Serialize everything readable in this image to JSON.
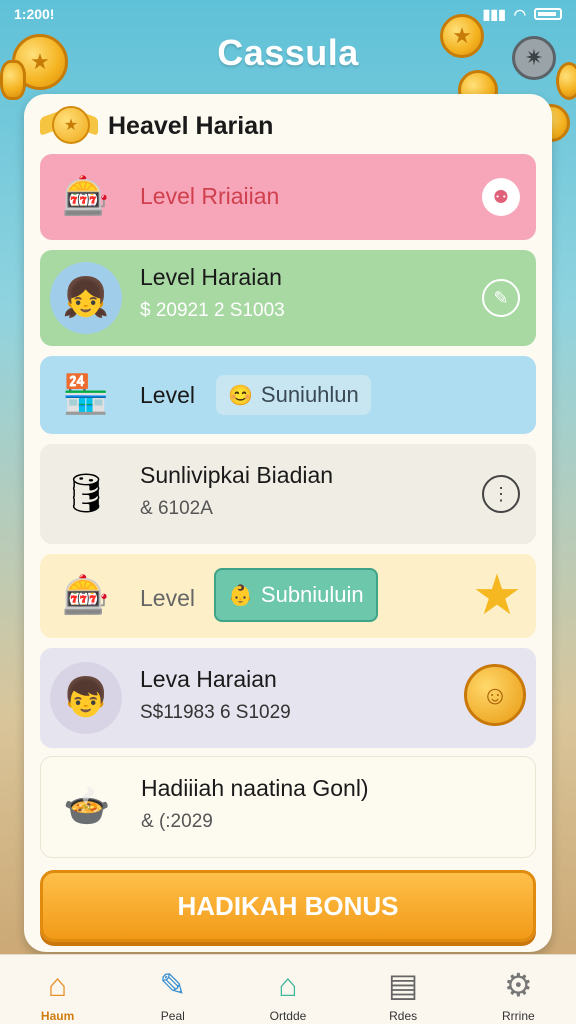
{
  "status_bar": {
    "time": "1:200!"
  },
  "app_title": "Cassula",
  "panel": {
    "title": "Heavel Harian",
    "cards": [
      {
        "title": "Level Rriaiian",
        "subtitle": "",
        "icon": "slot-machine-icon",
        "action_icon": "pink-badge-icon",
        "bg": "#f6a6b8"
      },
      {
        "title": "Level Haraian",
        "subtitle": "$ 20921 2 S1003",
        "icon": "girl-avatar-icon",
        "action_icon": "edit-circle-icon",
        "bg": "#a8d9a3"
      },
      {
        "title": "Level",
        "chip": "Suniuhlun",
        "icon": "shop-stall-icon",
        "bg": "#aedcf0"
      },
      {
        "title": "Sunlivipkai Biadian",
        "subtitle": "& 6102A",
        "icon": "barrel-icon",
        "action_icon": "info-circle-icon",
        "bg": "#f0ede4"
      },
      {
        "title": "Level",
        "chip": "Subniuluin",
        "icon": "slot-machine-icon",
        "action_icon": "sun-star-icon",
        "bg": "#fdf0c9"
      },
      {
        "title": "Leva Haraian",
        "subtitle": "S$11983 6 S1029",
        "icon": "boy-avatar-icon",
        "action_icon": "gold-medal-icon",
        "bg": "#e6e4ee"
      },
      {
        "title": "Hadiiiah naatina Gonl)",
        "subtitle": "& (:2029",
        "icon": "food-bowl-icon",
        "bg": "#fdfaf0"
      }
    ],
    "bonus_button": "HADIKAH BONUS"
  },
  "nav": [
    {
      "label": "Haum",
      "icon": "home-icon"
    },
    {
      "label": "Peal",
      "icon": "pencil-icon"
    },
    {
      "label": "Ortdde",
      "icon": "house-icon"
    },
    {
      "label": "Rdes",
      "icon": "document-icon"
    },
    {
      "label": "Rrrine",
      "icon": "settings-icon"
    }
  ]
}
